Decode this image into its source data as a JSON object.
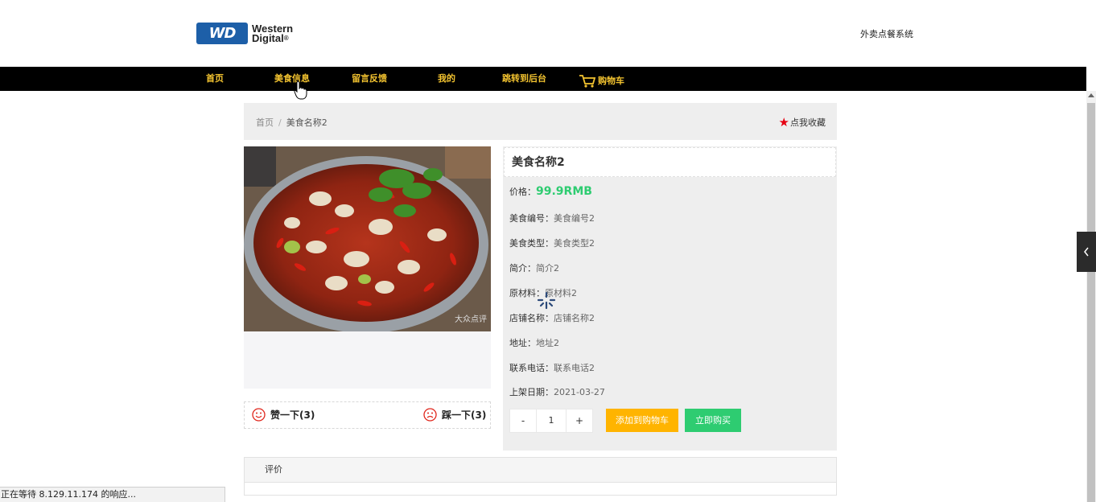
{
  "header": {
    "logo_badge": "WD",
    "logo_line1": "Western",
    "logo_line2": "Digital",
    "logo_reg": "®",
    "site_title": "外卖点餐系统"
  },
  "nav": {
    "items": [
      {
        "label": "首页"
      },
      {
        "label": "美食信息"
      },
      {
        "label": "留言反馈"
      },
      {
        "label": "我的"
      },
      {
        "label": "跳转到后台"
      },
      {
        "label": "购物车"
      }
    ]
  },
  "breadcrumb": {
    "home": "首页",
    "separator": "/",
    "current": "美食名称2"
  },
  "favorite": {
    "icon": "star-icon",
    "label": "点我收藏",
    "color": "#e60012"
  },
  "image": {
    "watermark": "大众点评"
  },
  "likes": {
    "like_label": "赞一下(3)",
    "dislike_label": "踩一下(3)"
  },
  "detail": {
    "name": "美食名称2",
    "price_label": "价格：",
    "price": "99.9RMB",
    "fields": [
      {
        "key": "美食编号：",
        "value": "美食编号2"
      },
      {
        "key": "美食类型：",
        "value": "美食类型2"
      },
      {
        "key": "简介：",
        "value": "简介2"
      },
      {
        "key": "原材料：",
        "value": "原材料2"
      },
      {
        "key": "店铺名称：",
        "value": "店铺名称2"
      },
      {
        "key": "地址：",
        "value": "地址2"
      },
      {
        "key": "联系电话：",
        "value": "联系电话2"
      },
      {
        "key": "上架日期：",
        "value": "2021-03-27"
      }
    ],
    "qty_minus": "-",
    "qty_value": "1",
    "qty_plus": "+",
    "add_cart": "添加到购物车",
    "buy_now": "立即购买"
  },
  "comments": {
    "title": "评价"
  },
  "status_bar": {
    "text": "正在等待 8.129.11.174 的响应..."
  },
  "colors": {
    "nav_bg": "#000000",
    "nav_text": "#f4c430",
    "price": "#2ecc71",
    "add_cart_bg": "#ffb400",
    "buy_bg": "#2ecc71"
  }
}
